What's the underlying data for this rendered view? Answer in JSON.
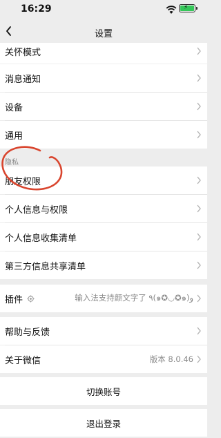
{
  "status": {
    "time": "16:29"
  },
  "nav": {
    "title": "设置"
  },
  "rows": {
    "care_mode": "关怀模式",
    "notifications": "消息通知",
    "devices": "设备",
    "general": "通用",
    "privacy_header": "隐私",
    "friend_permissions": "朋友权限",
    "personal_info_permissions": "个人信息与权限",
    "personal_info_list": "个人信息收集清单",
    "third_party_list": "第三方信息共享清单",
    "plugins": "插件",
    "plugins_value": "输入法支持颜文字了 ٩(๑✪◡✪๑)و",
    "help_feedback": "帮助与反馈",
    "about_wechat": "关于微信",
    "about_value": "版本 8.0.46",
    "switch_account": "切换账号",
    "logout": "退出登录"
  },
  "colors": {
    "annotation": "#d9452e",
    "battery": "#34c759"
  }
}
